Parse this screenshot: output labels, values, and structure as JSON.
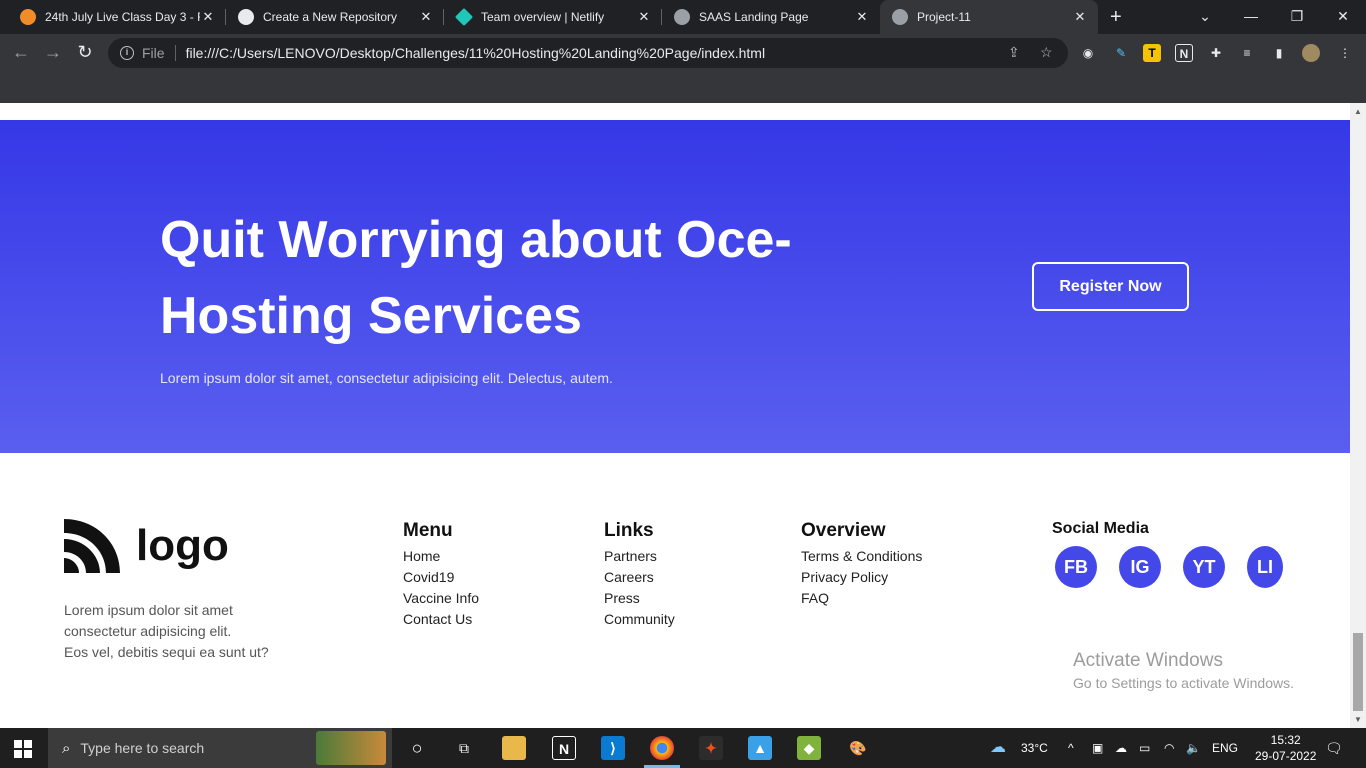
{
  "browser": {
    "tabs": [
      {
        "title": "24th July Live Class Day 3 - Fi",
        "fav_color": "#f28c28"
      },
      {
        "title": "Create a New Repository",
        "fav_color": "#e8eaed"
      },
      {
        "title": "Team overview | Netlify",
        "fav_color": "#20c6b7"
      },
      {
        "title": "SAAS Landing Page",
        "fav_color": "#9aa0a6"
      },
      {
        "title": "Project-11",
        "fav_color": "#9aa0a6"
      }
    ],
    "new_tab": "+",
    "address_prefix": "File",
    "url": "file:///C:/Users/LENOVO/Desktop/Challenges/11%20Hosting%20Landing%20Page/index.html"
  },
  "hero": {
    "title": "Quit Worrying about Oce-Hosting Services",
    "subtitle": "Lorem ipsum dolor sit amet, consectetur adipisicing elit. Delectus, autem.",
    "cta": "Register Now"
  },
  "footer": {
    "logo_text": "logo",
    "about": [
      "Lorem ipsum dolor sit amet",
      "consectetur adipisicing elit.",
      "Eos vel, debitis sequi ea sunt ut?"
    ],
    "menu": {
      "heading": "Menu",
      "links": [
        "Home",
        "Covid19",
        "Vaccine Info",
        "Contact Us"
      ]
    },
    "links": {
      "heading": "Links",
      "links": [
        "Partners",
        "Careers",
        "Press",
        "Community"
      ]
    },
    "overview": {
      "heading": "Overview",
      "links": [
        "Terms & Conditions",
        "Privacy Policy",
        "FAQ"
      ]
    },
    "social": {
      "heading": "Social Media",
      "items": [
        "FB",
        "IG",
        "YT",
        "LI"
      ]
    }
  },
  "watermark": {
    "title": "Activate Windows",
    "subtitle": "Go to Settings to activate Windows."
  },
  "taskbar": {
    "search_placeholder": "Type here to search",
    "weather": "33°C",
    "language": "ENG",
    "time": "15:32",
    "date": "29-07-2022"
  },
  "colors": {
    "hero_top": "#3538e6",
    "hero_bottom": "#5a5ff0",
    "social_circle": "#4548e8"
  }
}
